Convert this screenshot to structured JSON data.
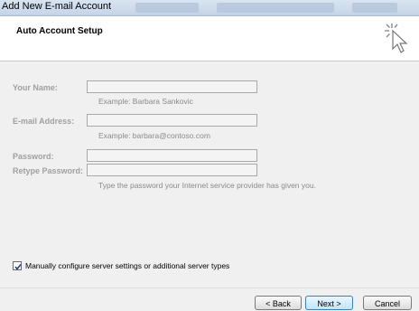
{
  "window": {
    "title": "Add New E-mail Account"
  },
  "header": {
    "heading": "Auto Account Setup",
    "icon": "cursor-click-icon"
  },
  "form": {
    "your_name": {
      "label": "Your Name:",
      "value": "",
      "example": "Example: Barbara Sankovic"
    },
    "email": {
      "label": "E-mail Address:",
      "value": "",
      "example": "Example: barbara@contoso.com"
    },
    "password": {
      "label": "Password:",
      "value": ""
    },
    "retype_password": {
      "label": "Retype Password:",
      "value": "",
      "hint": "Type the password your Internet service provider has given you."
    }
  },
  "manual_config": {
    "label": "Manually configure server settings or additional server types",
    "checked": true
  },
  "buttons": {
    "back": "< Back",
    "next": "Next >",
    "cancel": "Cancel"
  }
}
